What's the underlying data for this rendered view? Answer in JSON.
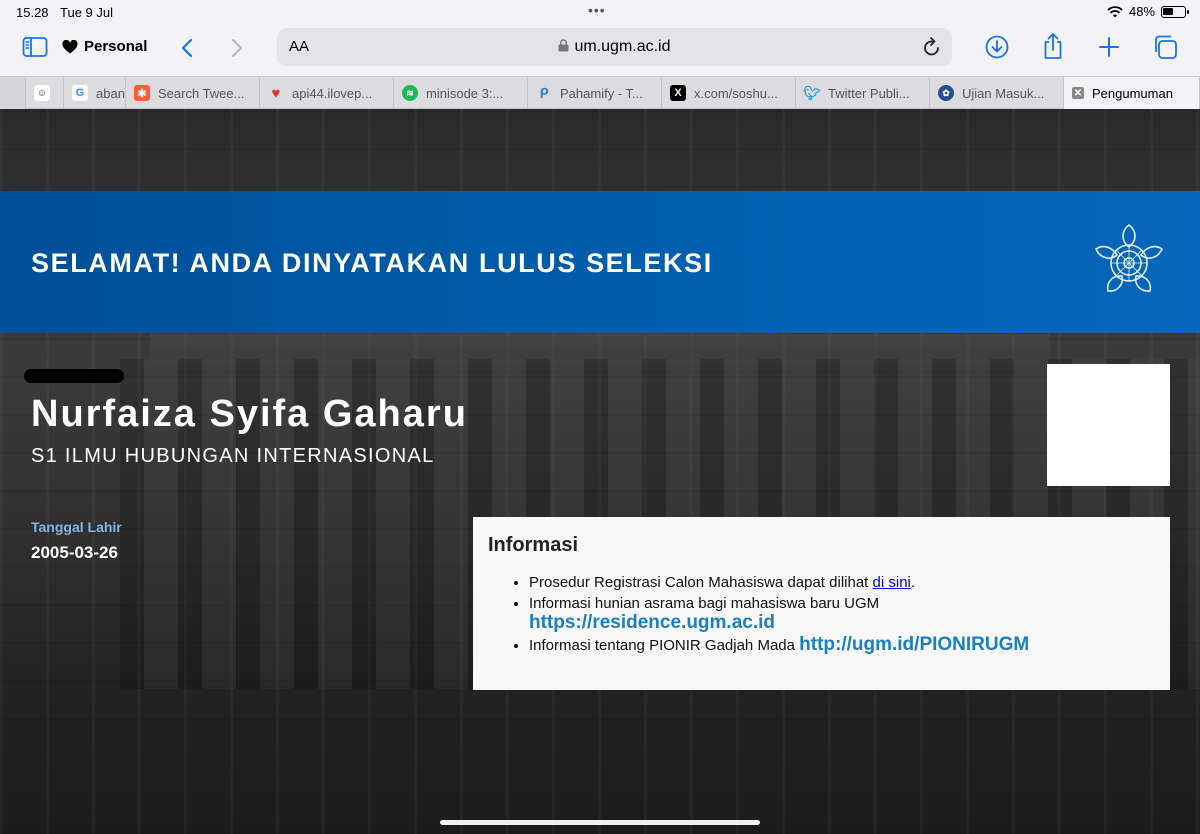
{
  "status": {
    "time": "15.28",
    "date": "Tue 9 Jul",
    "battery": "48%",
    "battery_level": 0.48
  },
  "toolbar": {
    "profile": "Personal",
    "aa": "AA",
    "url": "um.ugm.ac.id"
  },
  "tabs": [
    {
      "label": "",
      "icon": "avatar-icon",
      "color": "#ffffff"
    },
    {
      "label": "aban",
      "icon": "google-icon",
      "color": "#ffffff"
    },
    {
      "label": "Search Twee...",
      "icon": "hubspot-icon",
      "color": "#ff5c35"
    },
    {
      "label": "api44.ilovep...",
      "icon": "heart-icon",
      "color": "#e5322d"
    },
    {
      "label": "minisode 3:...",
      "icon": "spotify-icon",
      "color": "#1db954"
    },
    {
      "label": "Pahamify - T...",
      "icon": "pahamify-icon",
      "color": "#3a7bd5"
    },
    {
      "label": "x.com/soshu...",
      "icon": "x-icon",
      "color": "#000000"
    },
    {
      "label": "Twitter Publi...",
      "icon": "twitter-icon",
      "color": "#1d9bf0"
    },
    {
      "label": "Ujian Masuk...",
      "icon": "ugm-seal-icon",
      "color": "#2a4d8f"
    },
    {
      "label": "Pengumuman",
      "icon": "close-icon",
      "color": "#888888"
    }
  ],
  "banner": {
    "title": "SELAMAT! ANDA DINYATAKAN LULUS SELEKSI"
  },
  "student": {
    "name": "Nurfaiza Syifa Gaharu",
    "program": "S1 ILMU HUBUNGAN INTERNASIONAL",
    "dob_label": "Tanggal Lahir",
    "dob": "2005-03-26"
  },
  "info": {
    "title": "Informasi",
    "item1_text": "Prosedur Registrasi Calon Mahasiswa dapat dilihat ",
    "item1_link": "di sini",
    "item1_end": ".",
    "item2_text": "Informasi hunian asrama bagi mahasiswa baru UGM",
    "item2_link": "https://residence.ugm.ac.id",
    "item3_text": "Informasi tentang PIONIR Gadjah Mada ",
    "item3_link": "http://ugm.id/PIONIRUGM"
  },
  "colors": {
    "banner": "#0060b0",
    "link": "#1a7fc4",
    "accent": "#1a73e8"
  }
}
